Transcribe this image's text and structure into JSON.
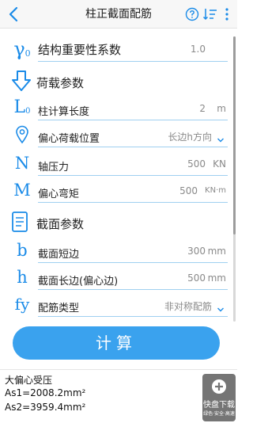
{
  "header": {
    "title": "柱正截面配筋"
  },
  "importance_factor": {
    "symbol": "γ",
    "subscript": "0",
    "label": "结构重要性系数",
    "value": "1.0"
  },
  "load_section": {
    "title": "荷载参数",
    "items": [
      {
        "symbol": "L",
        "subscript": "0",
        "label": "柱计算长度",
        "value": "2",
        "unit": "m"
      },
      {
        "label": "偏心荷载位置",
        "value": "长边h方向"
      },
      {
        "symbol": "N",
        "label": "轴压力",
        "value": "500",
        "unit": "KN"
      },
      {
        "symbol": "M",
        "label": "偏心弯矩",
        "value": "500",
        "unit": "KN·m"
      }
    ]
  },
  "section_params": {
    "title": "截面参数",
    "items": [
      {
        "symbol": "b",
        "label": "截面短边",
        "value": "300",
        "unit": "mm"
      },
      {
        "symbol": "h",
        "label": "截面长边(偏心边)",
        "value": "500",
        "unit": "mm"
      },
      {
        "symbol": "fy",
        "label": "配筋类型",
        "value": "非对称配筋"
      }
    ]
  },
  "calculate_button": "计算",
  "result": {
    "line1": "大偏心受压",
    "line2": "As1=2008.2mm²",
    "line3": "As2=3959.4mm²"
  },
  "watermark": {
    "brand": "快盘下载",
    "tagline": "绿色·安全·高速"
  },
  "colors": {
    "accent": "#1a8be8",
    "button": "#3aa2ee",
    "underline": "#9fd0f0"
  }
}
